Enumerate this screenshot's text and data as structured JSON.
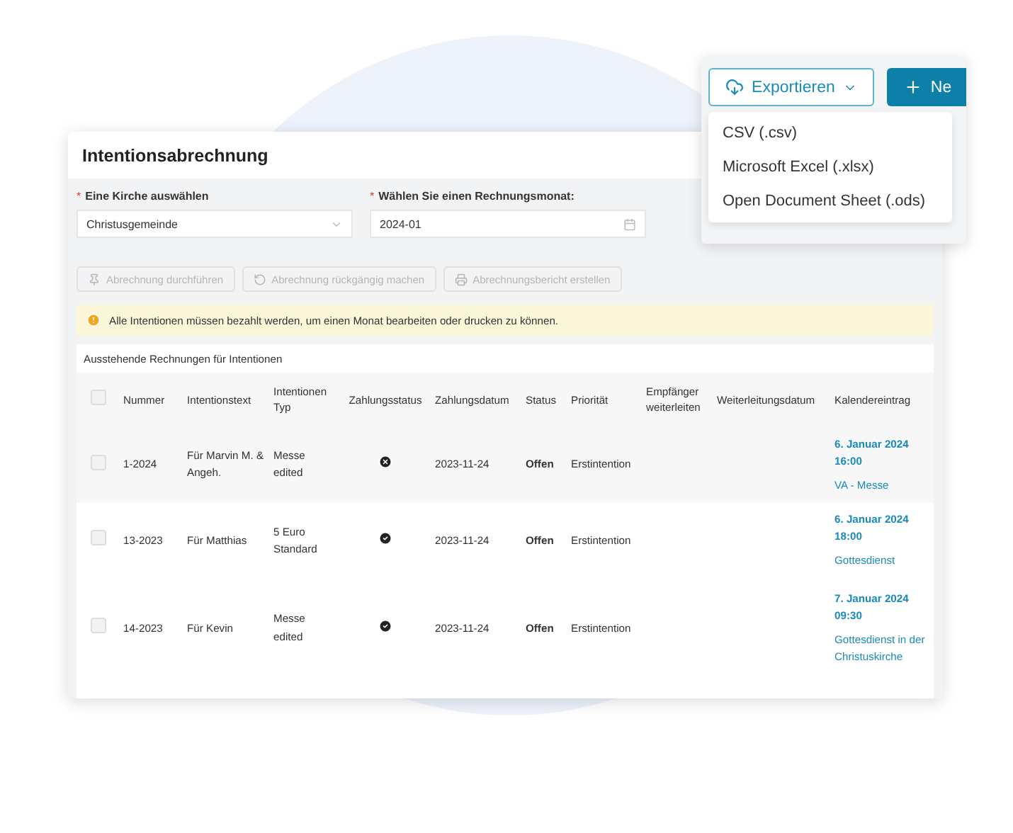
{
  "card": {
    "title": "Intentionsabrechnung"
  },
  "form": {
    "fields": [
      {
        "kind": "select",
        "required_mark": "*",
        "label": "Eine Kirche auswählen",
        "value": "Christusgemeinde"
      },
      {
        "kind": "date",
        "required_mark": "*",
        "label": "Wählen Sie einen Rechnungsmonat:",
        "value": "2024-01"
      }
    ]
  },
  "actions": [
    {
      "label": "Abrechnung durchführen",
      "disabled": true
    },
    {
      "label": "Abrechnung rückgängig machen",
      "disabled": true
    },
    {
      "label": "Abrechnungsbericht erstellen",
      "disabled": true
    }
  ],
  "alert": {
    "text": "Alle Intentionen müssen bezahlt werden, um einen Monat bearbeiten oder drucken zu können."
  },
  "table": {
    "caption": "Ausstehende Rechnungen für Intentionen",
    "all_checked": false,
    "columns": [
      "Nummer",
      "Intentionstext",
      "Intentionen Typ",
      "Zahlungsstatus",
      "Zahlungsdatum",
      "Status",
      "Priorität",
      "Empfänger weiterleiten",
      "Weiterleitungsdatum",
      "Kalendereintrag"
    ],
    "rows": [
      {
        "checked": false,
        "number": "1-2024",
        "text": "Für Marvin M. & Angeh.",
        "type": "Messe edited",
        "paid": false,
        "payment_date": "2023-11-24",
        "status": "Offen",
        "priority": "Erstintention",
        "event_date": "6. Januar 2024 16:00",
        "event_name": "VA - Messe"
      },
      {
        "checked": false,
        "number": "13-2023",
        "text": "Für Matthias",
        "type": "5 Euro Standard",
        "paid": true,
        "payment_date": "2023-11-24",
        "status": "Offen",
        "priority": "Erstintention",
        "event_date": "6. Januar 2024 18:00",
        "event_name": "Gottesdienst"
      },
      {
        "checked": false,
        "number": "14-2023",
        "text": "Für Kevin",
        "type": "Messe edited",
        "paid": true,
        "payment_date": "2023-11-24",
        "status": "Offen",
        "priority": "Erstintention",
        "event_date": "7. Januar 2024 09:30",
        "event_name": "Gottesdienst in der Christuskirche"
      }
    ]
  },
  "export_menu": {
    "button": "Exportieren",
    "expanded": true,
    "new_button": "Ne",
    "items": [
      "CSV (.csv)",
      "Microsoft Excel (.xlsx)",
      "Open Document Sheet (.ods)"
    ]
  }
}
